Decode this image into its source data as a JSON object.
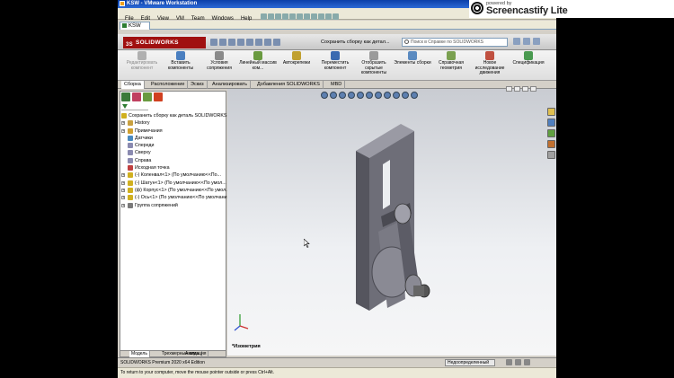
{
  "vm": {
    "window_title": "KSW - VMware Workstation",
    "menu": [
      "File",
      "Edit",
      "View",
      "VM",
      "Team",
      "Windows",
      "Help"
    ],
    "tab_label": "KSW",
    "status_message": "To return to your computer, move the mouse pointer outside or press Ctrl+Alt."
  },
  "screencastify": {
    "small": "powered by",
    "name": "Screencastify Lite"
  },
  "solidworks": {
    "logo": "SOLIDWORKS",
    "logo_prefix": "3S",
    "doc_title": "Сохранить сборку как детал...",
    "search_placeholder": "Поиск в Справке по SOLIDWORKS",
    "commands": [
      {
        "label": "Редактировать компонент",
        "disabled": true,
        "color": "#b0b0b0"
      },
      {
        "label": "Вставить компоненты",
        "disabled": false,
        "color": "#4a7fc0"
      },
      {
        "label": "Условия сопряжения",
        "disabled": false,
        "color": "#8a8a8a"
      },
      {
        "label": "Линейный массив ком...",
        "disabled": false,
        "color": "#6a9a40"
      },
      {
        "label": "Автокрепежи",
        "disabled": false,
        "color": "#c0a030"
      },
      {
        "label": "Переместить компонент",
        "disabled": false,
        "color": "#3a6ab0"
      },
      {
        "label": "Отобразить скрытые компоненты",
        "disabled": false,
        "color": "#9a9a9a"
      },
      {
        "label": "Элементы сборки",
        "disabled": false,
        "color": "#5a8ac0"
      },
      {
        "label": "Справочная геометрия",
        "disabled": false,
        "color": "#7aa050"
      },
      {
        "label": "Новое исследование движения",
        "disabled": false,
        "color": "#c05040"
      },
      {
        "label": "Спецификация",
        "disabled": false,
        "color": "#4a9a50"
      }
    ],
    "cm_tabs": [
      "Сборка",
      "Расположение",
      "Эскиз",
      "Анализировать",
      "Добавления SOLIDWORKS",
      "MBD"
    ],
    "tree_root": "Сохранить сборку как деталь SOLIDWORKS",
    "tree": [
      {
        "label": "History",
        "expandable": true,
        "icon_color": "#c8a040"
      },
      {
        "label": "Примечания",
        "expandable": true,
        "icon_color": "#d0a030"
      },
      {
        "label": "Датчики",
        "expandable": false,
        "icon_color": "#4a8ac0"
      },
      {
        "label": "Спереди",
        "expandable": false,
        "icon_color": "#8a8ab0"
      },
      {
        "label": "Сверху",
        "expandable": false,
        "icon_color": "#8a8ab0"
      },
      {
        "label": "Справа",
        "expandable": false,
        "icon_color": "#8a8ab0"
      },
      {
        "label": "Исходная точка",
        "expandable": false,
        "icon_color": "#c04040"
      },
      {
        "label": "(-) Коленвал<1> (По умолчанию<<По...",
        "expandable": true,
        "icon_color": "#d0b020"
      },
      {
        "label": "(-) Шатун<1> (По умолчанию<<По умол...",
        "expandable": true,
        "icon_color": "#d0b020"
      },
      {
        "label": "(ф) Корпус<1> (По умолчанию<<По умол...",
        "expandable": true,
        "icon_color": "#d0b020"
      },
      {
        "label": "(-) Ось<1> (По умолчанию<<По умолчани...",
        "expandable": true,
        "icon_color": "#d0b020"
      },
      {
        "label": "Группа сопряжений",
        "expandable": true,
        "icon_color": "#7a7a7a"
      }
    ],
    "bottom_tabs": [
      "Модель",
      "Трехмерные виды",
      "Анимация"
    ],
    "view_label": "*Изометрия",
    "status_left": "SOLIDWORKS Premium 2020 x64 Edition",
    "status_right": "Недоопределенный"
  },
  "colors": {
    "accent": "#a01010",
    "model_face": "#6e6e78",
    "model_light": "#9a9aa4",
    "model_dark": "#4a4a52"
  }
}
